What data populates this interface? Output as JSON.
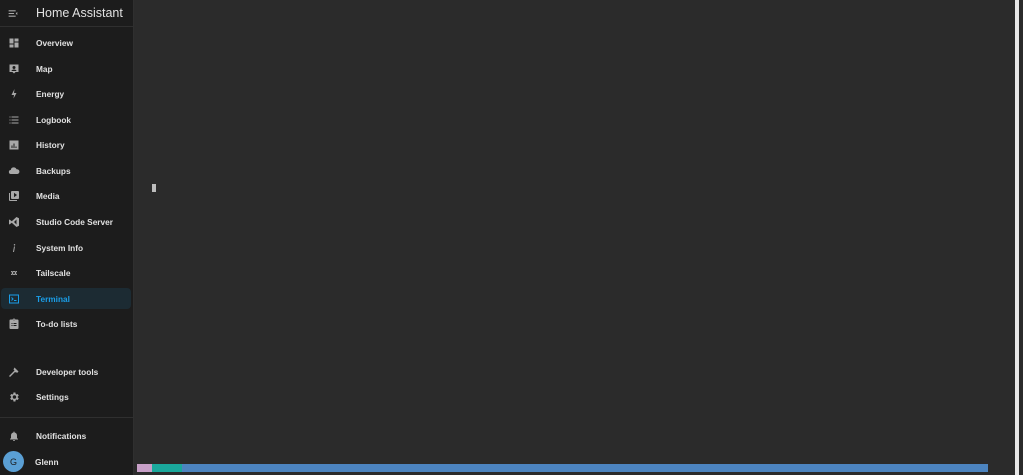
{
  "sidebar": {
    "title": "Home Assistant",
    "items": [
      {
        "label": "Overview",
        "icon": "dashboard-icon"
      },
      {
        "label": "Map",
        "icon": "map-icon"
      },
      {
        "label": "Energy",
        "icon": "lightning-icon"
      },
      {
        "label": "Logbook",
        "icon": "list-icon"
      },
      {
        "label": "History",
        "icon": "chart-icon"
      },
      {
        "label": "Backups",
        "icon": "cloud-icon"
      },
      {
        "label": "Media",
        "icon": "media-icon"
      },
      {
        "label": "Studio Code Server",
        "icon": "vscode-icon"
      },
      {
        "label": "System Info",
        "icon": "info-icon"
      },
      {
        "label": "Tailscale",
        "icon": "tailscale-icon"
      },
      {
        "label": "Terminal",
        "icon": "terminal-icon",
        "active": true
      },
      {
        "label": "To-do lists",
        "icon": "clipboard-icon"
      }
    ],
    "bottom_items": [
      {
        "label": "Developer tools",
        "icon": "hammer-icon"
      },
      {
        "label": "Settings",
        "icon": "gear-icon"
      }
    ],
    "notifications_label": "Notifications",
    "user": {
      "name": "Glenn",
      "initial": "G"
    }
  },
  "terminal": {
    "status_colors": [
      "#c8a0c8",
      "#1aa89c",
      "#4c84c0"
    ]
  },
  "colors": {
    "accent": "#1a9ee8",
    "sidebar_bg": "#1c1c1c",
    "main_bg": "#2b2b2b"
  }
}
